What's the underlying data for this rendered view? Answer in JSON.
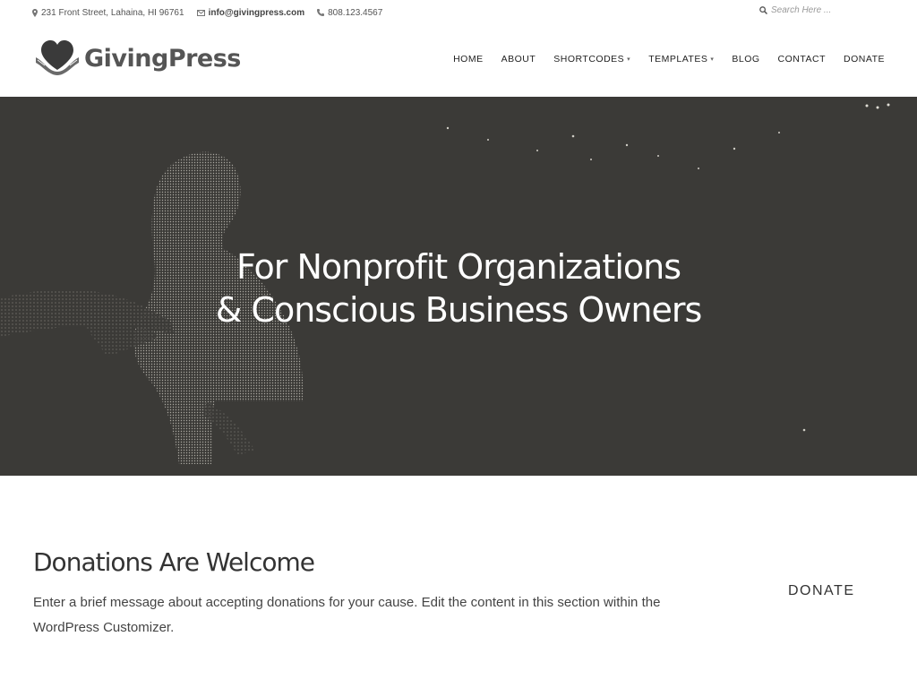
{
  "topbar": {
    "address": "231 Front Street, Lahaina, HI 96761",
    "email": "info@givingpress.com",
    "phone": "808.123.4567",
    "search_placeholder": "Search Here ..."
  },
  "header": {
    "logo_text": "GivingPress",
    "nav": [
      {
        "label": "HOME"
      },
      {
        "label": "ABOUT"
      },
      {
        "label": "SHORTCODES",
        "has_dropdown": true
      },
      {
        "label": "TEMPLATES",
        "has_dropdown": true
      },
      {
        "label": "BLOG"
      },
      {
        "label": "CONTACT"
      },
      {
        "label": "DONATE"
      }
    ]
  },
  "hero": {
    "line1": "For Nonprofit Organizations",
    "line2": "& Conscious Business Owners"
  },
  "donations": {
    "heading": "Donations Are Welcome",
    "message": "Enter a brief message about accepting donations for your cause. Edit the content in this section within the WordPress Customizer.",
    "button_label": "DONATE"
  },
  "icons": {
    "address": "map-marker-icon",
    "email": "envelope-icon",
    "phone": "phone-icon",
    "search": "search-icon",
    "logo": "heart-hands-icon",
    "dropdown": "chevron-down-icon"
  },
  "colors": {
    "hero_bg": "#3b3a37",
    "text_dark": "#333333",
    "hero_text": "#ffffff"
  }
}
